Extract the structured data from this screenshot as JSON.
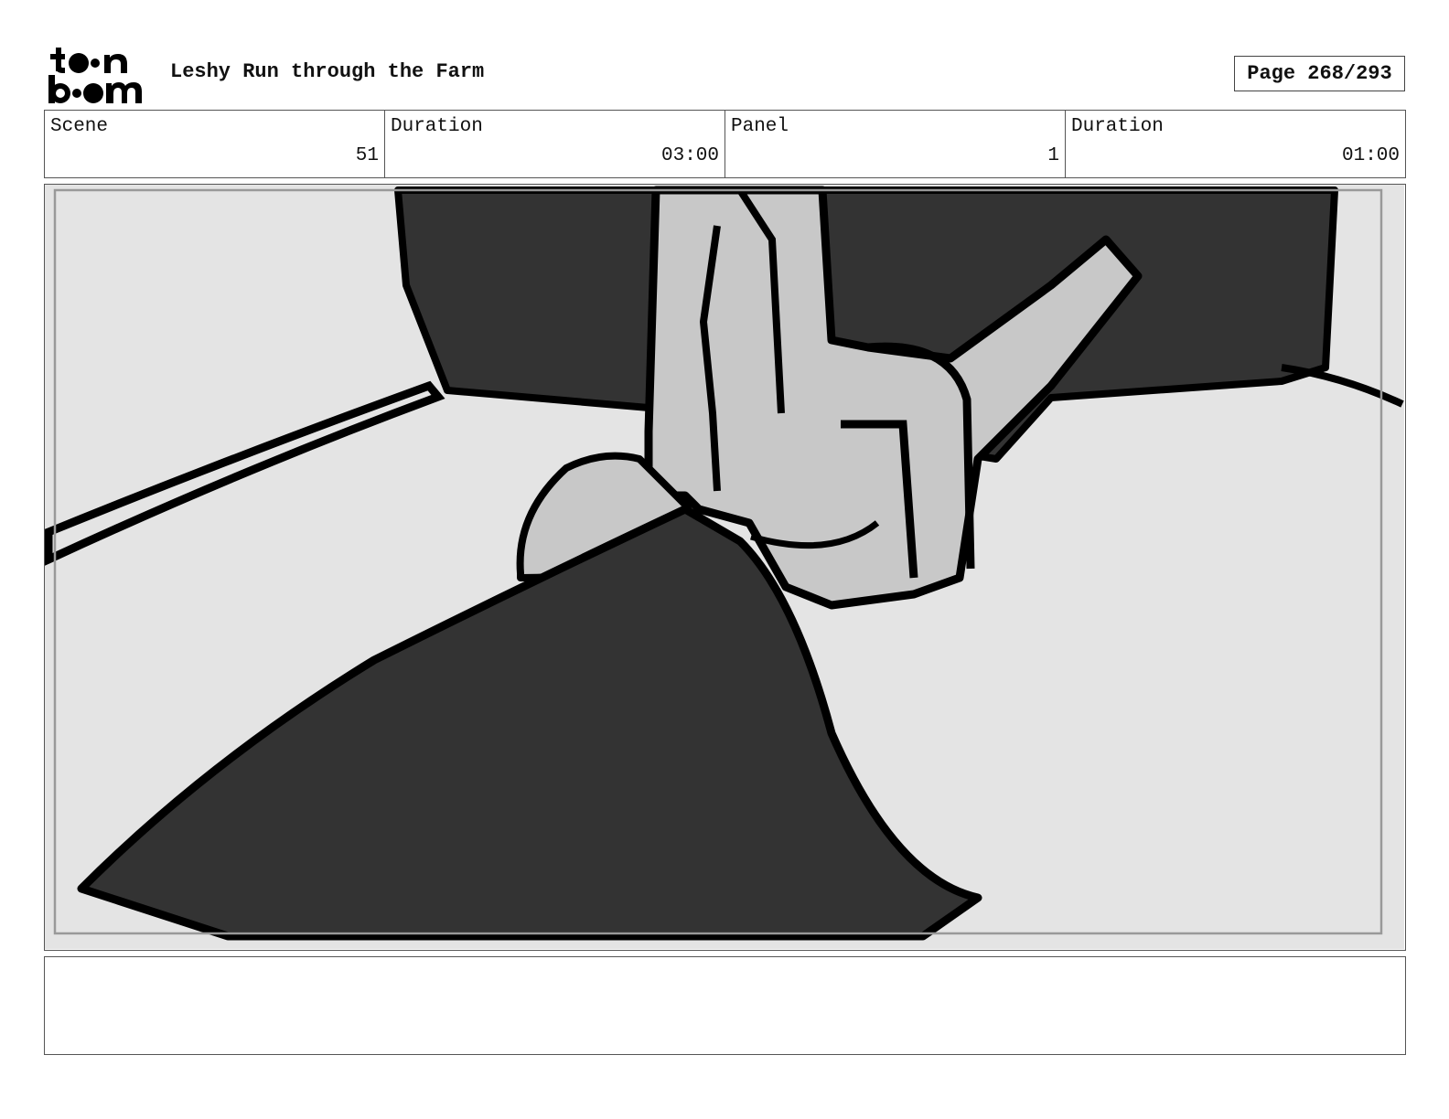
{
  "header": {
    "logo_name": "toonboom-logo",
    "project_title": "Leshy Run through the Farm",
    "page_label": "Page 268/293"
  },
  "info_bar": {
    "scene_label": "Scene",
    "scene_value": "51",
    "scene_duration_label": "Duration",
    "scene_duration_value": "03:00",
    "panel_label": "Panel",
    "panel_value": "1",
    "panel_duration_label": "Duration",
    "panel_duration_value": "01:00"
  },
  "panel": {
    "colors": {
      "background": "#e4e4e4",
      "dark_fill": "#333333",
      "hand_fill": "#c8c8c8",
      "outline": "#000000",
      "safe_frame": "#999999"
    }
  },
  "notes": {
    "text": ""
  }
}
